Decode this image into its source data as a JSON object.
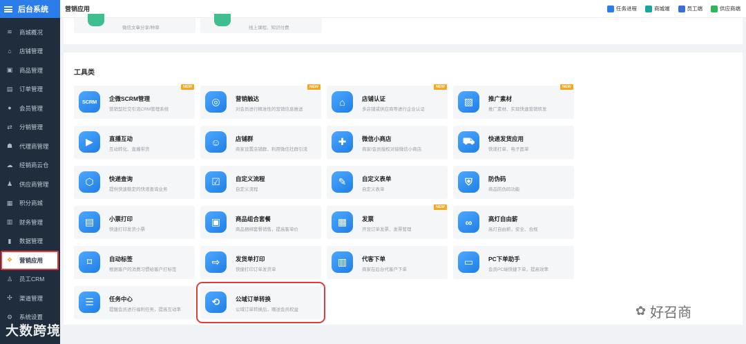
{
  "sidebar": {
    "brand": "后台系统",
    "items": [
      {
        "label": "商城概况",
        "icon": "layers-icon",
        "glyph": "≋"
      },
      {
        "label": "店铺管理",
        "icon": "shop-icon",
        "glyph": "⌂"
      },
      {
        "label": "商品管理",
        "icon": "box-icon",
        "glyph": "▣"
      },
      {
        "label": "订单管理",
        "icon": "order-icon",
        "glyph": "▤"
      },
      {
        "label": "会员管理",
        "icon": "member-icon",
        "glyph": "●"
      },
      {
        "label": "分销管理",
        "icon": "distribution-icon",
        "glyph": "⇄"
      },
      {
        "label": "代理商管理",
        "icon": "agent-icon",
        "glyph": "☗"
      },
      {
        "label": "经销商云仓",
        "icon": "cloud-icon",
        "glyph": "☁"
      },
      {
        "label": "供应商管理",
        "icon": "supplier-icon",
        "glyph": "♟"
      },
      {
        "label": "积分商城",
        "icon": "points-icon",
        "glyph": "▦"
      },
      {
        "label": "财务管理",
        "icon": "wallet-icon",
        "glyph": "▥"
      },
      {
        "label": "数据管理",
        "icon": "chart-icon",
        "glyph": "▮"
      },
      {
        "label": "营销应用",
        "icon": "apps-icon",
        "glyph": "❖",
        "active": true
      },
      {
        "label": "员工CRM",
        "icon": "crm-icon",
        "glyph": "♙"
      },
      {
        "label": "渠道管理",
        "icon": "channel-icon",
        "glyph": "✣"
      },
      {
        "label": "系统设置",
        "icon": "gear-icon",
        "glyph": "⚙"
      }
    ]
  },
  "header": {
    "title": "营销应用",
    "links": [
      {
        "label": "任务进程",
        "icon": "bell-icon",
        "color": "#2b7de9"
      },
      {
        "label": "商城端",
        "icon": "qrcode-icon",
        "color": "#19a59b"
      },
      {
        "label": "员工端",
        "icon": "staff-icon",
        "color": "#3b6fd1"
      },
      {
        "label": "供应商端",
        "icon": "supplier-end-icon",
        "color": "#2eb85c"
      }
    ]
  },
  "top_tiles": [
    {
      "desc": "微信文章分享/种草"
    },
    {
      "desc": "线上课程、知识付费"
    }
  ],
  "tools": {
    "section_title": "工具类",
    "badge": "NEW",
    "tiles": [
      {
        "name": "企微SCRM管理",
        "desc": "营销型社交引流CRM管理系统",
        "icon": "scrm-icon",
        "glyph": "SCRM",
        "new": true
      },
      {
        "name": "营销触达",
        "desc": "对会员进行精准性的营销信息推送",
        "icon": "target-icon",
        "glyph": "◎",
        "new": true
      },
      {
        "name": "店铺认证",
        "desc": "多店铺或供应商等进行企业认证",
        "icon": "store-icon",
        "glyph": "⌂",
        "new": true
      },
      {
        "name": "推广素材",
        "desc": "推广素材、实现快速营销转发",
        "icon": "image-icon",
        "glyph": "▨",
        "new": true
      },
      {
        "name": "直播互动",
        "desc": "互动转化、直播带货",
        "icon": "live-icon",
        "glyph": "▶"
      },
      {
        "name": "店铺群",
        "desc": "商家设置店铺群、利用微信社群引流",
        "icon": "group-chat-icon",
        "glyph": "☺"
      },
      {
        "name": "微信小商店",
        "desc": "商家/会员授权对接微信小商店",
        "icon": "shopping-bag-icon",
        "glyph": "✚"
      },
      {
        "name": "快递发货应用",
        "desc": "快递打单、电子面单",
        "icon": "truck-icon",
        "glyph": "⛟"
      },
      {
        "name": "快递查询",
        "desc": "提供快速稳定的快递查询业务",
        "icon": "parcel-search-icon",
        "glyph": "⬡"
      },
      {
        "name": "自定义流程",
        "desc": "自定义流程",
        "icon": "flow-icon",
        "glyph": "☑"
      },
      {
        "name": "自定义表单",
        "desc": "自定义表单",
        "icon": "form-icon",
        "glyph": "✎"
      },
      {
        "name": "防伪码",
        "desc": "商品防伪码功能",
        "icon": "shield-icon",
        "glyph": "⛨"
      },
      {
        "name": "小票打印",
        "desc": "快速打印发货小票",
        "icon": "printer-icon",
        "glyph": "▤"
      },
      {
        "name": "商品组合套餐",
        "desc": "商品捆绑套餐销售，提高客单价",
        "icon": "bundle-icon",
        "glyph": "▣"
      },
      {
        "name": "发票",
        "desc": "开设订单发票、发票管理",
        "icon": "invoice-icon",
        "glyph": "▦",
        "new": true
      },
      {
        "name": "高灯自由薪",
        "desc": "高灯自由薪，安全、合规",
        "icon": "infinity-icon",
        "glyph": "∞"
      },
      {
        "name": "自动标签",
        "desc": "根据客户的消费习惯给客户打标签",
        "icon": "tag-icon",
        "glyph": "⌑"
      },
      {
        "name": "发货单打印",
        "desc": "快捷打印订单发货单",
        "icon": "delivery-note-icon",
        "glyph": "⇨"
      },
      {
        "name": "代客下单",
        "desc": "商家在后台代客户下单",
        "icon": "proxy-order-icon",
        "glyph": "▥"
      },
      {
        "name": "PC下单助手",
        "desc": "会员PC端快捷下单，提高效率",
        "icon": "monitor-icon",
        "glyph": "▭"
      },
      {
        "name": "任务中心",
        "desc": "提醒会员进行福利任务，提高互动率",
        "icon": "clipboard-icon",
        "glyph": "☰"
      },
      {
        "name": "公域订单转换",
        "desc": "公域订单转换后，赠送会员权益",
        "icon": "order-convert-icon",
        "glyph": "⟲",
        "highlight": true
      }
    ]
  },
  "watermark": {
    "left": "大数跨境",
    "right": "好召商"
  }
}
